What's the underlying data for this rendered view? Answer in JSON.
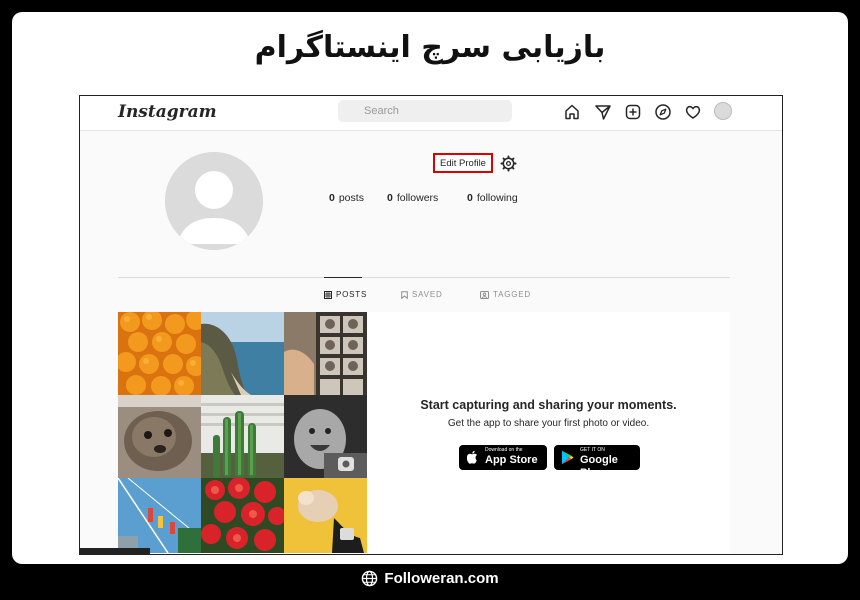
{
  "banner": {
    "title": "بازیابی سرچ اینستاگرام"
  },
  "instagram": {
    "logo": "Instagram",
    "search": {
      "placeholder": "Search"
    },
    "nav_icons": [
      "home-icon",
      "direct-icon",
      "new-post-icon",
      "explore-icon",
      "activity-heart-icon",
      "profile-avatar"
    ],
    "profile": {
      "edit_label": "Edit Profile",
      "stats": {
        "posts_count": "0",
        "posts_label": "posts",
        "followers_count": "0",
        "followers_label": "followers",
        "following_count": "0",
        "following_label": "following"
      }
    },
    "tabs": [
      {
        "label": "POSTS",
        "icon": "grid-icon",
        "active": true
      },
      {
        "label": "SAVED",
        "icon": "bookmark-icon",
        "active": false
      },
      {
        "label": "TAGGED",
        "icon": "tag-icon",
        "active": false
      }
    ],
    "empty_state": {
      "title": "Start capturing and sharing your moments.",
      "subtitle": "Get the app to share your first photo or video.",
      "app_store": {
        "small": "Download on the",
        "big": "App Store"
      },
      "google_play": {
        "small": "GET IT ON",
        "big": "Google Play"
      }
    },
    "colors": {
      "highlight_border": "#dd0000",
      "search_bg": "#efefef",
      "page_bg": "#fafafa"
    }
  },
  "footer": {
    "site": "Followeran.com",
    "icon": "globe-icon"
  }
}
